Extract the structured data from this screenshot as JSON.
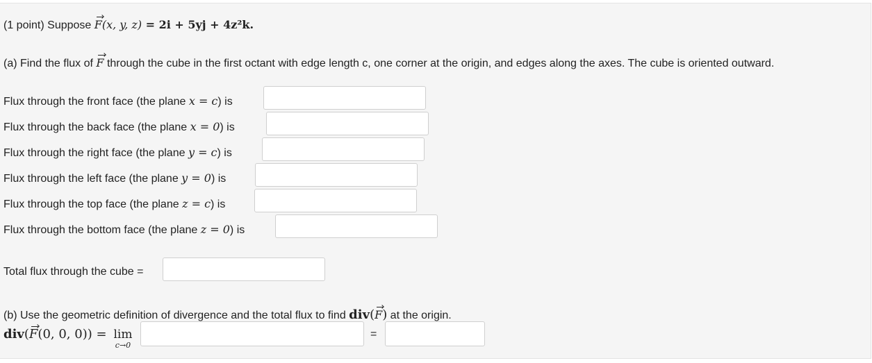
{
  "problem": {
    "header_prefix": "(1 point) Suppose ",
    "field_name": "F",
    "field_args": "(x, y, z)",
    "field_expr": " = 2i + 5yj + 4z²k."
  },
  "part_a": {
    "intro_prefix": "(a) Find the flux of ",
    "vector": "F",
    "intro_suffix": " through the cube in the first octant with edge length c, one corner at the origin, and edges along the axes. The cube is oriented outward.",
    "faces": [
      {
        "label_prefix": "Flux through the front face (the plane ",
        "equation": "x = c",
        "label_suffix": ") is",
        "value": ""
      },
      {
        "label_prefix": "Flux through the back face (the plane ",
        "equation": "x = 0",
        "label_suffix": ") is",
        "value": ""
      },
      {
        "label_prefix": "Flux through the right face (the plane ",
        "equation": "y = c",
        "label_suffix": ") is",
        "value": ""
      },
      {
        "label_prefix": "Flux through the left face (the plane ",
        "equation": "y = 0",
        "label_suffix": ") is",
        "value": ""
      },
      {
        "label_prefix": "Flux through the top face (the plane ",
        "equation": "z = c",
        "label_suffix": ") is",
        "value": ""
      },
      {
        "label_prefix": "Flux through the bottom face (the plane ",
        "equation": "z = 0",
        "label_suffix": ") is",
        "value": ""
      }
    ],
    "total_label": "Total flux through the cube =",
    "total_value": ""
  },
  "part_b": {
    "intro_prefix": "(b) Use the geometric definition of divergence and the total flux to find ",
    "div_word": "div",
    "div_open": "(",
    "vector": "F",
    "div_close": ")",
    "intro_suffix": " at the origin.",
    "lhs_word": "div",
    "lhs_open": "(",
    "lhs_vector": "F",
    "lhs_args": "(0, 0, 0)) = ",
    "lim_word": "lim",
    "lim_sub": "c→0",
    "limit_value": "",
    "equals": "=",
    "result_value": ""
  }
}
